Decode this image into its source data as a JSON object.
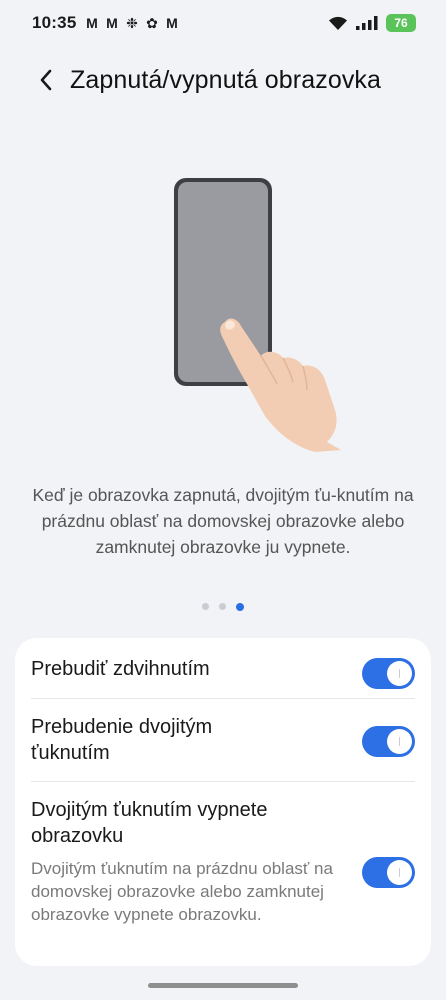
{
  "status_bar": {
    "time": "10:35",
    "notification_icons": [
      "M",
      "M",
      "❉",
      "✿",
      "M"
    ],
    "battery": "76"
  },
  "header": {
    "title": "Zapnutá/vypnutá obrazovka"
  },
  "illustration": {
    "description_text": "Keď je obrazovka zapnutá, dvojitým ťu-knutím na prázdnu oblasť na domovskej obrazovke alebo zamknutej obrazovke ju vypnete."
  },
  "pager": {
    "count": 3,
    "active_index": 2
  },
  "settings": [
    {
      "title": "Prebudiť zdvihnutím",
      "enabled": true
    },
    {
      "title": "Prebudenie dvojitým ťuknutím",
      "enabled": true
    },
    {
      "title": "Dvojitým ťuknutím vypnete obrazovku",
      "subtitle": "Dvojitým ťuknutím na prázdnu oblasť na domovskej obrazovke alebo zamknutej obrazovke vypnete obrazovku.",
      "enabled": true
    }
  ],
  "colors": {
    "background": "#f1f3f6",
    "accent": "#2d6fe4",
    "battery": "#5ac35a"
  }
}
